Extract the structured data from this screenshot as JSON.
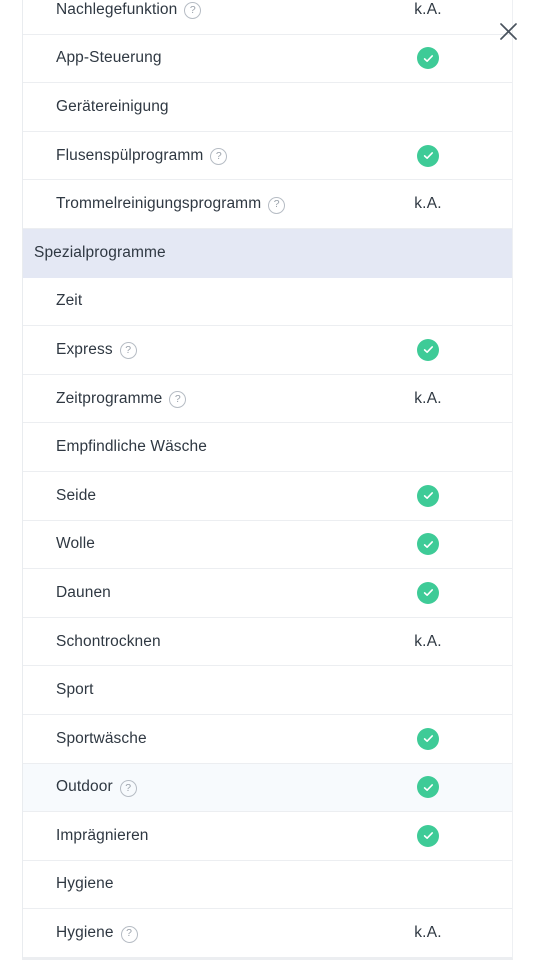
{
  "panel": {
    "close_button_label": "Schließen",
    "icons": {
      "close": "close-icon",
      "help": "help-circle-icon",
      "supported": "check-circle-icon"
    },
    "values": {
      "not_available": "k.A.",
      "supported": "✓"
    },
    "colors": {
      "check_green": "#3ecb97",
      "section_band": "#e4e8f4",
      "row_highlight": "#f7fafd",
      "text": "#2f3842",
      "divider": "#eceef1",
      "help_outline": "#b6bcc4"
    },
    "rows": [
      {
        "type": "item",
        "label": "Nachlegefunktion",
        "help": true,
        "value": "k.A.",
        "check": false,
        "highlight": false,
        "clipped_top": true
      },
      {
        "type": "item",
        "label": "App-Steuerung",
        "help": false,
        "value": "",
        "check": true,
        "highlight": false
      },
      {
        "type": "group",
        "label": "Gerätereinigung",
        "help": false,
        "value": "",
        "check": false,
        "highlight": false
      },
      {
        "type": "item",
        "label": "Flusenspülprogramm",
        "help": true,
        "value": "",
        "check": true,
        "highlight": false
      },
      {
        "type": "item",
        "label": "Trommelreinigungsprogramm",
        "help": true,
        "value": "k.A.",
        "check": false,
        "highlight": false
      },
      {
        "type": "section",
        "label": "Spezialprogramme",
        "help": false,
        "value": "",
        "check": false,
        "highlight": false
      },
      {
        "type": "group",
        "label": "Zeit",
        "help": false,
        "value": "",
        "check": false,
        "highlight": false
      },
      {
        "type": "item",
        "label": "Express",
        "help": true,
        "value": "",
        "check": true,
        "highlight": false
      },
      {
        "type": "item",
        "label": "Zeitprogramme",
        "help": true,
        "value": "k.A.",
        "check": false,
        "highlight": false
      },
      {
        "type": "group",
        "label": "Empfindliche Wäsche",
        "help": false,
        "value": "",
        "check": false,
        "highlight": false
      },
      {
        "type": "item",
        "label": "Seide",
        "help": false,
        "value": "",
        "check": true,
        "highlight": false
      },
      {
        "type": "item",
        "label": "Wolle",
        "help": false,
        "value": "",
        "check": true,
        "highlight": false
      },
      {
        "type": "item",
        "label": "Daunen",
        "help": false,
        "value": "",
        "check": true,
        "highlight": false
      },
      {
        "type": "item",
        "label": "Schontrocknen",
        "help": false,
        "value": "k.A.",
        "check": false,
        "highlight": false
      },
      {
        "type": "group",
        "label": "Sport",
        "help": false,
        "value": "",
        "check": false,
        "highlight": false
      },
      {
        "type": "item",
        "label": "Sportwäsche",
        "help": false,
        "value": "",
        "check": true,
        "highlight": false
      },
      {
        "type": "item",
        "label": "Outdoor",
        "help": true,
        "value": "",
        "check": true,
        "highlight": true
      },
      {
        "type": "item",
        "label": "Imprägnieren",
        "help": false,
        "value": "",
        "check": true,
        "highlight": false
      },
      {
        "type": "group",
        "label": "Hygiene",
        "help": false,
        "value": "",
        "check": false,
        "highlight": false
      },
      {
        "type": "item",
        "label": "Hygiene",
        "help": true,
        "value": "k.A.",
        "check": false,
        "highlight": false
      }
    ]
  }
}
